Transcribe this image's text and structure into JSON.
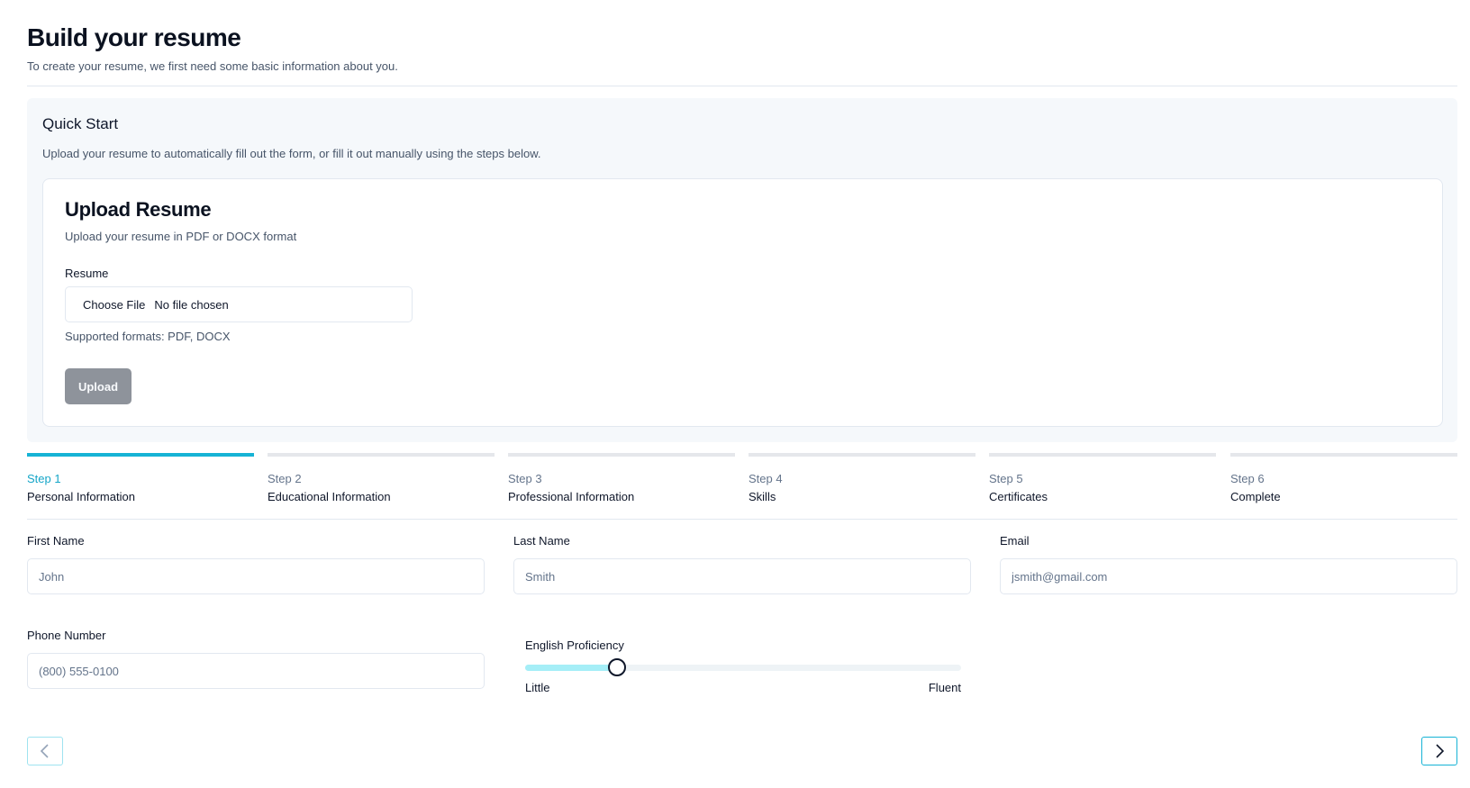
{
  "header": {
    "title": "Build your resume",
    "subtitle": "To create your resume, we first need some basic information about you."
  },
  "quick_start": {
    "title": "Quick Start",
    "description": "Upload your resume to automatically fill out the form, or fill it out manually using the steps below.",
    "card": {
      "title": "Upload Resume",
      "description": "Upload your resume in PDF or DOCX format",
      "field_label": "Resume",
      "choose_file_label": "Choose File",
      "file_status": "No file chosen",
      "hint": "Supported formats: PDF, DOCX",
      "upload_label": "Upload"
    }
  },
  "steps": [
    {
      "num": "Step 1",
      "name": "Personal Information",
      "active": true
    },
    {
      "num": "Step 2",
      "name": "Educational Information",
      "active": false
    },
    {
      "num": "Step 3",
      "name": "Professional Information",
      "active": false
    },
    {
      "num": "Step 4",
      "name": "Skills",
      "active": false
    },
    {
      "num": "Step 5",
      "name": "Certificates",
      "active": false
    },
    {
      "num": "Step 6",
      "name": "Complete",
      "active": false
    }
  ],
  "form": {
    "first_name": {
      "label": "First Name",
      "placeholder": "John",
      "value": ""
    },
    "last_name": {
      "label": "Last Name",
      "placeholder": "Smith",
      "value": ""
    },
    "email": {
      "label": "Email",
      "placeholder": "jsmith@gmail.com",
      "value": ""
    },
    "phone": {
      "label": "Phone Number",
      "placeholder": "(800) 555-0100",
      "value": ""
    },
    "english": {
      "label": "English Proficiency",
      "min_label": "Little",
      "max_label": "Fluent",
      "level": 0.21
    }
  },
  "nav": {
    "prev_icon": "chevron-left-icon",
    "next_icon": "chevron-right-icon"
  },
  "colors": {
    "accent": "#16b3d5",
    "slider_fill": "#a5eef7",
    "upload_button_bg": "#8e939b",
    "panel_bg": "#f5f8fb"
  }
}
